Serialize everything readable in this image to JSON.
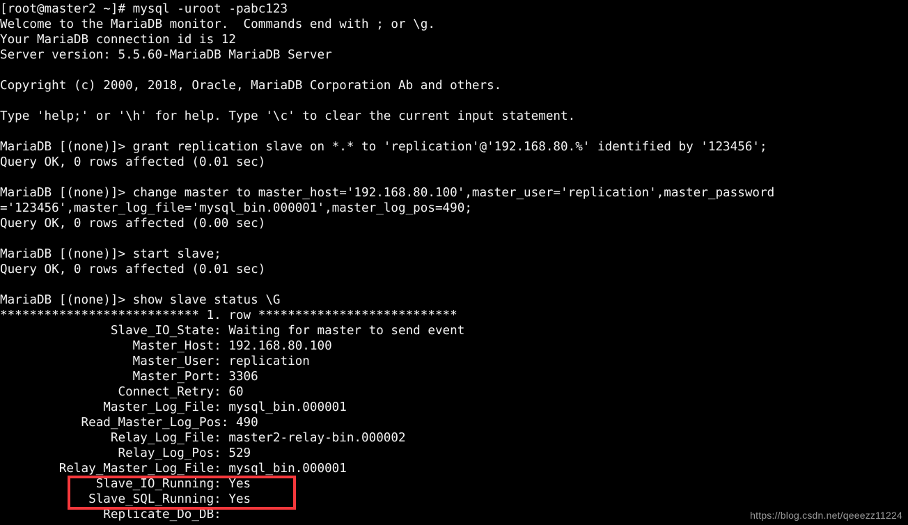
{
  "terminal": {
    "prompt_host": "[root@master2 ~]#",
    "colors": {
      "background": "#000000",
      "foreground": "#f2f2f2",
      "highlight_border": "#f5383c",
      "watermark": "#9a9a9a"
    },
    "lines": [
      "[root@master2 ~]# mysql -uroot -pabc123",
      "Welcome to the MariaDB monitor.  Commands end with ; or \\g.",
      "Your MariaDB connection id is 12",
      "Server version: 5.5.60-MariaDB MariaDB Server",
      "",
      "Copyright (c) 2000, 2018, Oracle, MariaDB Corporation Ab and others.",
      "",
      "Type 'help;' or '\\h' for help. Type '\\c' to clear the current input statement.",
      "",
      "MariaDB [(none)]> grant replication slave on *.* to 'replication'@'192.168.80.%' identified by '123456';",
      "Query OK, 0 rows affected (0.01 sec)",
      "",
      "MariaDB [(none)]> change master to master_host='192.168.80.100',master_user='replication',master_password",
      "='123456',master_log_file='mysql_bin.000001',master_log_pos=490;",
      "Query OK, 0 rows affected (0.00 sec)",
      "",
      "MariaDB [(none)]> start slave;",
      "Query OK, 0 rows affected (0.01 sec)",
      "",
      "MariaDB [(none)]> show slave status \\G",
      "*************************** 1. row ***************************",
      "               Slave_IO_State: Waiting for master to send event",
      "                  Master_Host: 192.168.80.100",
      "                  Master_User: replication",
      "                  Master_Port: 3306",
      "                Connect_Retry: 60",
      "              Master_Log_File: mysql_bin.000001",
      "           Read_Master_Log_Pos: 490",
      "               Relay_Log_File: master2-relay-bin.000002",
      "                Relay_Log_Pos: 529",
      "        Relay_Master_Log_File: mysql_bin.000001",
      "             Slave_IO_Running: Yes",
      "            Slave_SQL_Running: Yes",
      "              Replicate_Do_DB:"
    ]
  },
  "highlight": {
    "label": "slave-running-highlight",
    "lines_highlighted": [
      "Slave_IO_Running: Yes",
      "Slave_SQL_Running: Yes"
    ]
  },
  "watermark": {
    "text": "https://blog.csdn.net/qeeezz11224"
  }
}
